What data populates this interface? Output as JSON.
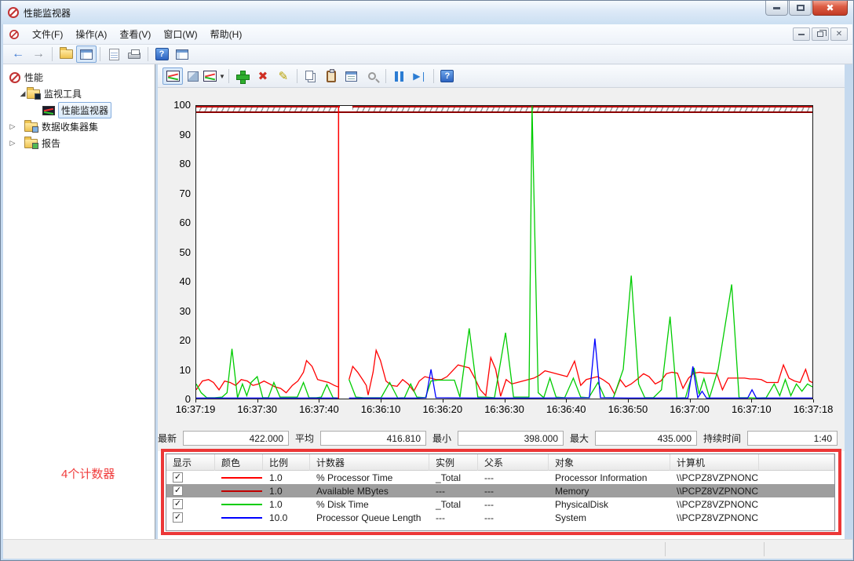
{
  "window": {
    "title": "性能监视器"
  },
  "menu": {
    "items": [
      "文件(F)",
      "操作(A)",
      "查看(V)",
      "窗口(W)",
      "帮助(H)"
    ]
  },
  "tree": {
    "root_label": "性能",
    "items": [
      {
        "label": "监视工具",
        "expanded": true
      },
      {
        "label": "性能监视器",
        "selected": true
      },
      {
        "label": "数据收集器集",
        "expanded": false
      },
      {
        "label": "报告",
        "expanded": false
      }
    ]
  },
  "chart": {
    "type": "line",
    "y_ticks": [
      "100",
      "90",
      "80",
      "70",
      "60",
      "50",
      "40",
      "30",
      "20",
      "10",
      "0"
    ],
    "x_labels": [
      "16:37:19",
      "16:37:30",
      "16:37:40",
      "16:36:10",
      "16:36:20",
      "16:36:30",
      "16:36:40",
      "16:36:50",
      "16:37:00",
      "16:37:10",
      "16:37:18"
    ],
    "ylim": [
      0,
      100
    ],
    "marker_x_pct": 23.1,
    "clip_gap": {
      "start_pct": 23.3,
      "end_pct": 25.4
    },
    "clipped_series": {
      "name": "Available MBytes",
      "note": "value 422 clipped at graph top",
      "top_color": "#bb0000",
      "bottom_color": "#8b0000"
    },
    "series": [
      {
        "name": "% Processor Time",
        "color": "#ff0000",
        "segments": [
          [
            [
              0,
              3
            ],
            [
              1,
              6
            ],
            [
              2,
              6.5
            ],
            [
              2.8,
              5.5
            ],
            [
              3.7,
              3
            ],
            [
              4.6,
              6
            ],
            [
              5.5,
              5.5
            ],
            [
              6.4,
              4.5
            ],
            [
              7.3,
              6.5
            ],
            [
              8.3,
              6
            ],
            [
              9.2,
              4.5
            ],
            [
              10.1,
              5
            ],
            [
              11,
              6
            ],
            [
              11.9,
              5
            ],
            [
              12.8,
              4
            ],
            [
              13.7,
              3.5
            ],
            [
              14.6,
              2
            ],
            [
              15.6,
              4.5
            ],
            [
              16.5,
              6
            ],
            [
              17.4,
              9
            ],
            [
              17.9,
              13
            ],
            [
              18.8,
              11
            ],
            [
              19.7,
              6.5
            ],
            [
              20.6,
              6
            ],
            [
              21.5,
              5.5
            ],
            [
              22.4,
              4.5
            ],
            [
              23,
              4
            ]
          ],
          [
            [
              24.8,
              6.5
            ],
            [
              25.4,
              11
            ],
            [
              26.2,
              9
            ],
            [
              27,
              6.5
            ],
            [
              27.6,
              4.5
            ],
            [
              27.9,
              1.2
            ],
            [
              28.7,
              9
            ],
            [
              29.2,
              16.5
            ],
            [
              29.9,
              13
            ],
            [
              30.8,
              6
            ],
            [
              31.7,
              4.5
            ],
            [
              32.6,
              4.2
            ],
            [
              33.5,
              6.5
            ],
            [
              34.4,
              5
            ],
            [
              35.3,
              2.5
            ],
            [
              36.2,
              6
            ],
            [
              37.1,
              7.5
            ],
            [
              38,
              7
            ],
            [
              38.9,
              6.5
            ],
            [
              39.8,
              6.5
            ],
            [
              40.7,
              7.5
            ],
            [
              41.6,
              9.5
            ],
            [
              42.5,
              11.5
            ],
            [
              43.4,
              11
            ],
            [
              44.3,
              10.5
            ],
            [
              45.2,
              7
            ],
            [
              46.1,
              3
            ],
            [
              47,
              1
            ],
            [
              47.8,
              14
            ],
            [
              48.6,
              10
            ],
            [
              49.4,
              0.8
            ],
            [
              50.3,
              6.5
            ],
            [
              51.2,
              5
            ],
            [
              52.1,
              5.5
            ],
            [
              53,
              6
            ],
            [
              53.9,
              6.5
            ],
            [
              54.8,
              7
            ],
            [
              55.7,
              8
            ],
            [
              56.6,
              9.5
            ],
            [
              57.5,
              9
            ],
            [
              58.4,
              8.5
            ],
            [
              59.3,
              8
            ],
            [
              60.2,
              7.5
            ],
            [
              61.4,
              12.8
            ],
            [
              62.4,
              4.5
            ],
            [
              63.3,
              6.5
            ],
            [
              64.2,
              7
            ],
            [
              65.1,
              7.5
            ],
            [
              66,
              6.5
            ],
            [
              67,
              5
            ],
            [
              67.9,
              1.5
            ],
            [
              68.8,
              6.5
            ],
            [
              69.7,
              4
            ],
            [
              70.6,
              5
            ],
            [
              71.5,
              6.5
            ],
            [
              72.6,
              8.5
            ],
            [
              73.5,
              7.5
            ],
            [
              74.5,
              5
            ],
            [
              75.4,
              6
            ],
            [
              76.3,
              8.5
            ],
            [
              77.2,
              9
            ],
            [
              78.1,
              8.7
            ],
            [
              79,
              3.5
            ],
            [
              79.9,
              7
            ],
            [
              80.8,
              8.7
            ],
            [
              81.7,
              9
            ],
            [
              82.6,
              8.7
            ],
            [
              83.5,
              8.7
            ],
            [
              84.5,
              8.5
            ],
            [
              85.4,
              3
            ],
            [
              86.3,
              7
            ],
            [
              87.2,
              7
            ],
            [
              88.1,
              7
            ],
            [
              89,
              7
            ],
            [
              89.9,
              6.7
            ],
            [
              90.8,
              6.7
            ],
            [
              91.7,
              6.5
            ],
            [
              92.6,
              5.5
            ],
            [
              93.5,
              5.5
            ],
            [
              94.4,
              5.5
            ],
            [
              95.3,
              11.5
            ],
            [
              96.2,
              7
            ],
            [
              97.1,
              6
            ],
            [
              98,
              5.5
            ],
            [
              98.9,
              10
            ],
            [
              99.5,
              6
            ],
            [
              100,
              5.5
            ]
          ]
        ]
      },
      {
        "name": "% Disk Time",
        "color": "#00cc00",
        "segments": [
          [
            [
              0,
              5
            ],
            [
              0.8,
              2
            ],
            [
              1.7,
              0.3
            ],
            [
              3,
              0.3
            ],
            [
              4.2,
              0.5
            ],
            [
              5,
              2
            ],
            [
              5.8,
              17
            ],
            [
              6.7,
              0.3
            ],
            [
              7.5,
              5
            ],
            [
              8.2,
              1
            ],
            [
              8.9,
              5.5
            ],
            [
              9.9,
              7.5
            ],
            [
              10.8,
              0.3
            ],
            [
              11.7,
              0.3
            ],
            [
              12.6,
              5.5
            ],
            [
              13.6,
              0.5
            ],
            [
              15,
              0.5
            ],
            [
              16.4,
              0.5
            ],
            [
              17.4,
              5.5
            ],
            [
              18.3,
              0.3
            ],
            [
              19.5,
              0.3
            ],
            [
              20.3,
              0.5
            ],
            [
              21.2,
              4.8
            ],
            [
              22.2,
              0.3
            ],
            [
              23,
              0.2
            ]
          ],
          [
            [
              24.8,
              6.5
            ],
            [
              25.9,
              0.5
            ],
            [
              27.2,
              0.3
            ],
            [
              28.6,
              0.3
            ],
            [
              30,
              0.3
            ],
            [
              31.4,
              5.5
            ],
            [
              32.7,
              0.2
            ],
            [
              33.8,
              0.3
            ],
            [
              34.8,
              5
            ],
            [
              35.8,
              0.5
            ],
            [
              37.2,
              0.3
            ],
            [
              38.1,
              6
            ],
            [
              39.2,
              6.3
            ],
            [
              40.5,
              6.3
            ],
            [
              41.9,
              6.3
            ],
            [
              42.8,
              0.5
            ],
            [
              44.3,
              24
            ],
            [
              45.7,
              0.5
            ],
            [
              47,
              0.5
            ],
            [
              48.4,
              0.3
            ],
            [
              50.2,
              22.5
            ],
            [
              51.5,
              0.5
            ],
            [
              52.9,
              0.5
            ],
            [
              54,
              0.5
            ],
            [
              54.5,
              100
            ],
            [
              55.5,
              2
            ],
            [
              56.4,
              0.3
            ],
            [
              57.4,
              7
            ],
            [
              58.4,
              0.5
            ],
            [
              59.8,
              0.3
            ],
            [
              61.2,
              7
            ],
            [
              62.4,
              0.5
            ],
            [
              63.7,
              0.3
            ],
            [
              65.2,
              5.5
            ],
            [
              66.3,
              0.3
            ],
            [
              67.7,
              0.3
            ],
            [
              69.3,
              10
            ],
            [
              70.6,
              42
            ],
            [
              71.8,
              5
            ],
            [
              72.8,
              0.3
            ],
            [
              74.2,
              0.3
            ],
            [
              75.5,
              3
            ],
            [
              76.9,
              28
            ],
            [
              78,
              0.2
            ],
            [
              79.4,
              0.3
            ],
            [
              80.8,
              10.5
            ],
            [
              81.6,
              1.5
            ],
            [
              82.4,
              6.8
            ],
            [
              83.3,
              0.3
            ],
            [
              84.7,
              10
            ],
            [
              86.9,
              39
            ],
            [
              88.1,
              0.3
            ],
            [
              89.5,
              0.3
            ],
            [
              91,
              0.2
            ],
            [
              92.5,
              0.3
            ],
            [
              93.8,
              5
            ],
            [
              94.7,
              1
            ],
            [
              95.6,
              6.5
            ],
            [
              96.5,
              1
            ],
            [
              97.4,
              5
            ],
            [
              98.3,
              2.5
            ],
            [
              99.2,
              5
            ],
            [
              100,
              4
            ]
          ]
        ]
      },
      {
        "name": "Processor Queue Length",
        "color": "#0000ff",
        "segments": [
          [
            [
              0,
              0.2
            ],
            [
              20,
              0.2
            ],
            [
              23,
              0.2
            ]
          ],
          [
            [
              24.8,
              0.2
            ],
            [
              36,
              0.2
            ],
            [
              37.3,
              0.3
            ],
            [
              38.1,
              10
            ],
            [
              38.9,
              0.3
            ],
            [
              45,
              0.2
            ],
            [
              55,
              0.2
            ],
            [
              63.8,
              0.3
            ],
            [
              64.7,
              20.5
            ],
            [
              65.6,
              0.3
            ],
            [
              70,
              0.2
            ],
            [
              79.8,
              0.2
            ],
            [
              80.6,
              11
            ],
            [
              81.4,
              0.3
            ],
            [
              82.1,
              2.5
            ],
            [
              82.8,
              0.2
            ],
            [
              89.5,
              0.2
            ],
            [
              90.2,
              3
            ],
            [
              90.9,
              0.2
            ],
            [
              100,
              0.2
            ]
          ]
        ]
      }
    ]
  },
  "stats": {
    "items": [
      {
        "label": "最新",
        "value": "422.000"
      },
      {
        "label": "平均",
        "value": "416.810"
      },
      {
        "label": "最小",
        "value": "398.000"
      },
      {
        "label": "最大",
        "value": "435.000"
      },
      {
        "label": "持续时间",
        "value": "1:40"
      }
    ]
  },
  "counter_table": {
    "columns": [
      "显示",
      "颜色",
      "比例",
      "计数器",
      "实例",
      "父系",
      "对象",
      "计算机"
    ],
    "rows": [
      {
        "checked": true,
        "color": "#ff0000",
        "scale": "1.0",
        "counter": "% Processor Time",
        "instance": "_Total",
        "parent": "---",
        "object": "Processor Information",
        "computer": "\\\\PCPZ8VZPNONC...",
        "selected": false
      },
      {
        "checked": true,
        "color": "#c00000",
        "scale": "1.0",
        "counter": "Available MBytes",
        "instance": "---",
        "parent": "---",
        "object": "Memory",
        "computer": "\\\\PCPZ8VZPNONC...",
        "selected": true
      },
      {
        "checked": true,
        "color": "#00cc00",
        "scale": "1.0",
        "counter": "% Disk Time",
        "instance": "_Total",
        "parent": "---",
        "object": "PhysicalDisk",
        "computer": "\\\\PCPZ8VZPNONC...",
        "selected": false
      },
      {
        "checked": true,
        "color": "#0000ff",
        "scale": "10.0",
        "counter": "Processor Queue Length",
        "instance": "---",
        "parent": "---",
        "object": "System",
        "computer": "\\\\PCPZ8VZPNONC...",
        "selected": false
      }
    ]
  },
  "annotation": {
    "label": "4个计数器"
  }
}
